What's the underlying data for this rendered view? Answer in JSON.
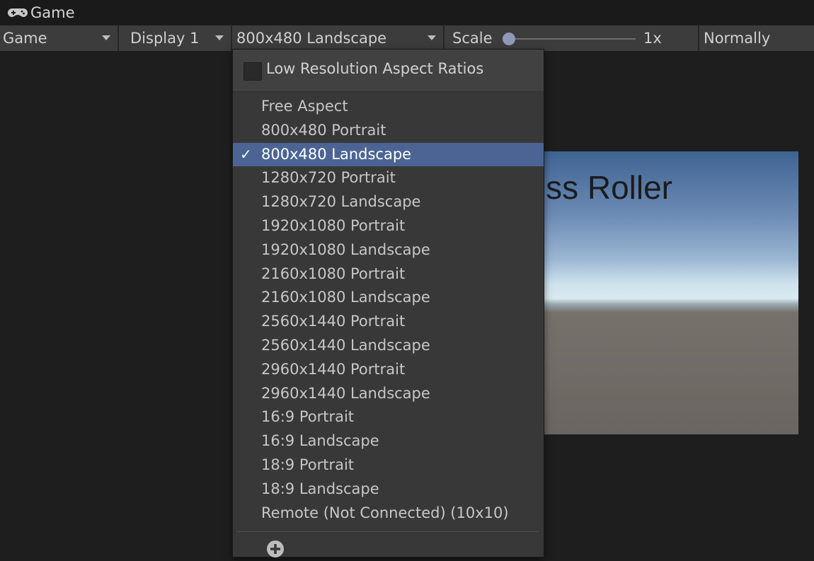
{
  "window": {
    "tab_title": "Game",
    "tab_icon": "gamepad-icon"
  },
  "toolbar": {
    "mode": "Game",
    "display": "Display 1",
    "resolution": "800x480 Landscape",
    "scale_label": "Scale",
    "scale_value": "1x",
    "play_mode": "Normally"
  },
  "game_view": {
    "title_text": "ss Roller"
  },
  "resolution_menu": {
    "low_res_label": "Low Resolution Aspect Ratios",
    "low_res_checked": false,
    "selected": "800x480 Landscape",
    "check_glyph": "✓",
    "items": [
      "Free Aspect",
      "800x480 Portrait",
      "800x480 Landscape",
      "1280x720 Portrait",
      "1280x720 Landscape",
      "1920x1080 Portrait",
      "1920x1080 Landscape",
      "2160x1080 Portrait",
      "2160x1080 Landscape",
      "2560x1440 Portrait",
      "2560x1440 Landscape",
      "2960x1440 Portrait",
      "2960x1440 Landscape",
      "16:9 Portrait",
      "16:9 Landscape",
      "18:9 Portrait",
      "18:9 Landscape",
      "Remote (Not Connected) (10x10)"
    ],
    "add_icon": "plus-circle-icon"
  },
  "colors": {
    "selection": "#4b6493",
    "toolbar": "#3c3c3c",
    "menu": "#383838"
  }
}
